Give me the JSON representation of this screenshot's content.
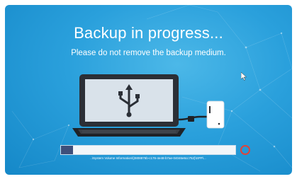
{
  "screen": {
    "title": "Backup in progress...",
    "subtitle": "Please do not remove the backup medium.",
    "background_color": "#2aa0dc"
  },
  "illustration": {
    "laptop_icon": "usb-icon",
    "device_icon": "external-drive-icon"
  },
  "progress": {
    "fraction": 0.07,
    "fill_color": "#3e4f7a",
    "path_text": "..\\System Volume Information\\{3808876b-c176-4e48-b7ae-04046e6cc752}\\SPP\\..."
  },
  "cancel": {
    "icon": "cancel-icon",
    "color": "#e0443a"
  }
}
